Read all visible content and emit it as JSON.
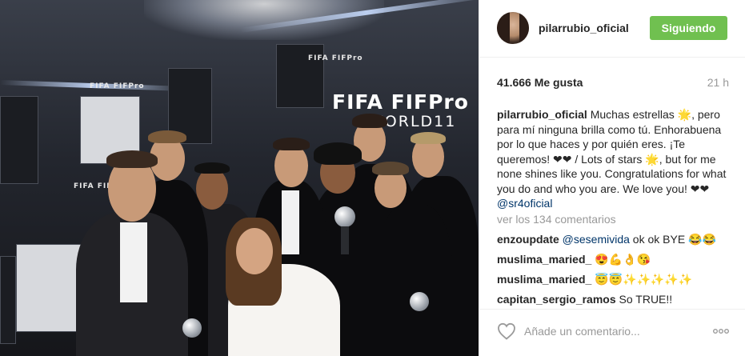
{
  "post": {
    "username": "pilarrubio_oficial",
    "follow_button_label": "Siguiendo",
    "likes": "41.666 Me gusta",
    "time_ago": "21 h",
    "caption": {
      "username": "pilarrubio_oficial",
      "text_before_mention": " Muchas estrellas 🌟, pero para mí ninguna brilla como tú. Enhorabuena por lo que haces y por quién eres. ¡Te queremos! ❤❤ / Lots of stars 🌟, but for me none shines like you. Congratulations for what you do and who you are. We love you! ❤❤ ",
      "mention": "@sr4oficial"
    },
    "view_all_comments": "ver los 134 comentarios",
    "comments": [
      {
        "username": "enzoupdate",
        "mention": "@sesemivida",
        "text": " ok ok BYE 😂😂"
      },
      {
        "username": "muslima_maried_",
        "mention": "",
        "text": " 😍💪👌😘"
      },
      {
        "username": "muslima_maried_",
        "mention": "",
        "text": " 😇😇✨✨✨✨✨"
      },
      {
        "username": "capitan_sergio_ramos",
        "mention": "",
        "text": " So TRUE!!"
      }
    ],
    "add_comment_placeholder": "Añade un comentario...",
    "icons": {
      "like": "heart-outline-icon",
      "more": "ellipsis-icon"
    }
  },
  "photo": {
    "brand_main": "FIFA FIFPro",
    "brand_sub": "WORLD11",
    "brand_small": "FIFA FIFPro"
  },
  "colors": {
    "follow_button_bg": "#70c050",
    "mention": "#003569",
    "muted_text": "#999999",
    "text": "#262626"
  }
}
